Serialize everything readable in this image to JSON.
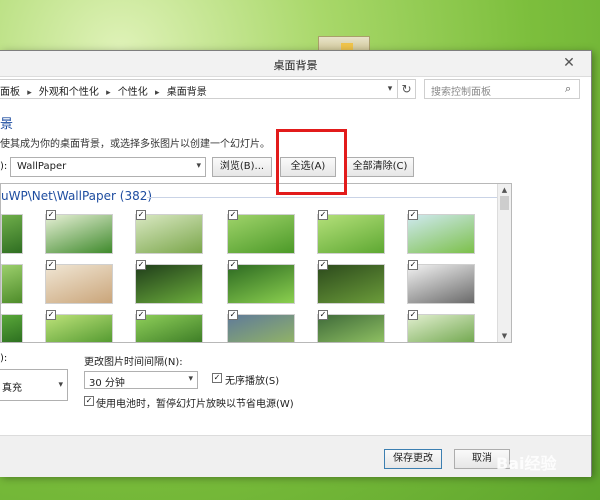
{
  "window": {
    "title": "桌面背景",
    "close_glyph": "✕"
  },
  "address": {
    "crumbs": [
      "面板",
      "外观和个性化",
      "个性化",
      "桌面背景"
    ],
    "separator": "▸",
    "dropdown_glyph": "▾",
    "refresh_glyph": "↻"
  },
  "search": {
    "placeholder": "搜索控制面板",
    "icon": "⌕"
  },
  "main": {
    "heading": "景",
    "description": "使其成为你的桌面背景，或选择多张图片以创建一个幻灯片。",
    "location_label": "):",
    "location_value": "WallPaper",
    "dropdown_glyph": "▾",
    "browse_label": "浏览(B)...",
    "select_all_label": "全选(A)",
    "clear_all_label": "全部清除(C)"
  },
  "gallery": {
    "group_title": "uWP\\Net\\WallPaper (382)",
    "check_glyph": "✓",
    "scroll_up": "▲",
    "scroll_down": "▼",
    "thumbs": [
      {
        "checked": true,
        "colors": [
          "#6fae4a",
          "#2f6e22"
        ]
      },
      {
        "checked": true,
        "colors": [
          "#e7f0d6",
          "#3f8a2c"
        ]
      },
      {
        "checked": true,
        "colors": [
          "#d9e8c2",
          "#7aa64a"
        ]
      },
      {
        "checked": true,
        "colors": [
          "#9fd36a",
          "#4c9a28"
        ]
      },
      {
        "checked": true,
        "colors": [
          "#b4e07a",
          "#5ea832"
        ]
      },
      {
        "checked": true,
        "colors": [
          "#cfe9f0",
          "#7cc04a"
        ]
      },
      {
        "checked": true,
        "colors": [
          "#9ccf6c",
          "#4e8c2a"
        ]
      },
      {
        "checked": true,
        "colors": [
          "#f0e6d4",
          "#caa57a"
        ]
      },
      {
        "checked": true,
        "colors": [
          "#1f3d1a",
          "#6cae3c"
        ]
      },
      {
        "checked": true,
        "colors": [
          "#2d6a22",
          "#8bd04f"
        ]
      },
      {
        "checked": true,
        "colors": [
          "#2c4a1c",
          "#6b9c3a"
        ]
      },
      {
        "checked": true,
        "colors": [
          "#f2f2f2",
          "#6a6a6a"
        ]
      },
      {
        "checked": true,
        "colors": [
          "#5aa83a",
          "#1f5e18"
        ]
      },
      {
        "checked": true,
        "colors": [
          "#bde27a",
          "#3f8c22"
        ]
      },
      {
        "checked": true,
        "colors": [
          "#8fcf5a",
          "#2d6d1c"
        ]
      },
      {
        "checked": true,
        "colors": [
          "#5f7a9a",
          "#9bbf5c"
        ]
      },
      {
        "checked": true,
        "colors": [
          "#3f6a3a",
          "#9fd26a"
        ]
      },
      {
        "checked": true,
        "colors": [
          "#e2efd0",
          "#5c9a36"
        ]
      }
    ]
  },
  "options": {
    "position_label": "):",
    "position_value": "真充",
    "interval_label": "更改图片时间间隔(N):",
    "interval_value": "30 分钟",
    "shuffle_label": "无序播放(S)",
    "shuffle_checked": true,
    "battery_label": "使用电池时，暂停幻灯片放映以节省电源(W)",
    "battery_checked": true
  },
  "footer": {
    "save_label": "保存更改",
    "cancel_label": "取消"
  },
  "watermark": "Bai经验",
  "colors": {
    "accent": "#1e4da0",
    "highlight": "#e21b1b"
  }
}
